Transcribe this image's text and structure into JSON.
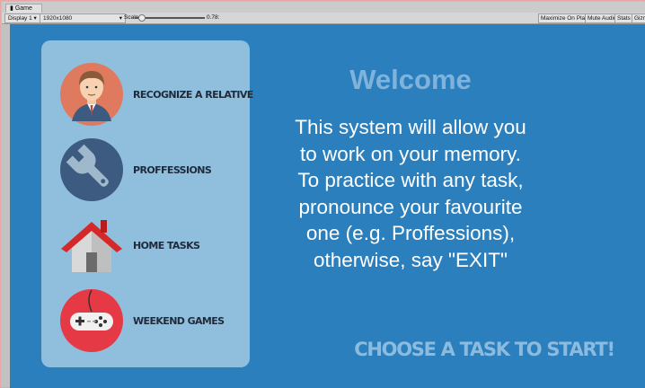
{
  "window": {
    "tab_label": "Game",
    "tab_icon": "game-icon"
  },
  "toolbar": {
    "display": "Display 1",
    "resolution": "1920x1080",
    "scale_label": "Scale",
    "scale_value": "0.78:",
    "maximize_label": "Maximize On Play",
    "mute_label": "Mute Audio",
    "stats_label": "Stats",
    "gizmos_label": "Gizmos"
  },
  "menu": {
    "items": [
      {
        "label": "RECOGNIZE A RELATIVE",
        "icon": "person-icon"
      },
      {
        "label": "PROFFESSIONS",
        "icon": "wrench-icon"
      },
      {
        "label": "HOME TASKS",
        "icon": "house-icon"
      },
      {
        "label": "WEEKEND GAMES",
        "icon": "gamepad-icon"
      }
    ]
  },
  "main": {
    "welcome": "Welcome",
    "message": "This system will allow you\nto work on your memory.\nTo practice with any task,\npronounce your favourite\none (e.g. Proffessions),\notherwise, say \"EXIT\"",
    "cta": "CHOOSE A TASK TO START!"
  },
  "colors": {
    "background": "#2b7fbd",
    "panel": "#8fbfdd",
    "accent": "#8cbbe0",
    "welcome": "#7fb3dc"
  }
}
